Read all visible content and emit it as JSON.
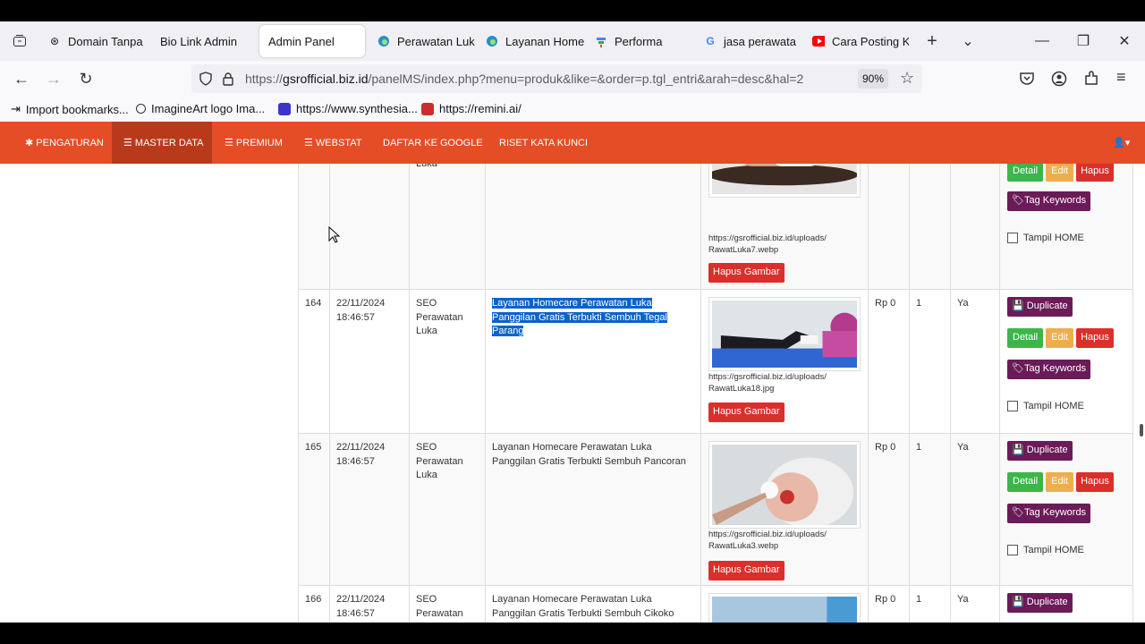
{
  "tabs": [
    {
      "label": "Domain Tanpa",
      "icon": "openai-icon"
    },
    {
      "label": "Bio Link Admin",
      "icon": ""
    },
    {
      "label": "Admin Panel",
      "icon": "",
      "active": true
    },
    {
      "label": "Perawatan Luk",
      "icon": "edge-icon"
    },
    {
      "label": "Layanan Home",
      "icon": "edge-icon"
    },
    {
      "label": "Performa",
      "icon": "search-console-icon"
    },
    {
      "label": "jasa perawata",
      "icon": "google-icon"
    },
    {
      "label": "Cara Posting K",
      "icon": "youtube-icon"
    }
  ],
  "address": {
    "prefix": "https://",
    "domain": "gsrofficial.biz.id",
    "path": "/panelMS/index.php?menu=produk&like=&order=p.tgl_entri&arah=desc&hal=2",
    "zoom": "90%"
  },
  "bookmarks": [
    "Import bookmarks...",
    "ImagineArt logo Ima...",
    "https://www.synthesia...",
    "https://remini.ai/"
  ],
  "menu": [
    "PENGATURAN",
    "MASTER DATA",
    "PREMIUM",
    "WEBSTAT",
    "DAFTAR KE GOOGLE",
    "RISET KATA KUNCI"
  ],
  "rows": [
    {
      "no": "",
      "date": "",
      "time": "",
      "cat": "Luka",
      "title": "",
      "path1": "https://gsrofficial.biz.id/uploads/",
      "path2": "RawatLuka7.webp",
      "price": "",
      "qty": "",
      "status": ""
    },
    {
      "no": "164",
      "date": "22/11/2024",
      "time": "18:46:57",
      "cat": "SEO Perawatan Luka",
      "title": "Layanan Homecare Perawatan Luka Panggilan Gratis Terbukti Sembuh Tegal Parang",
      "path1": "https://gsrofficial.biz.id/uploads/",
      "path2": "RawatLuka18.jpg",
      "price": "Rp 0",
      "qty": "1",
      "status": "Ya"
    },
    {
      "no": "165",
      "date": "22/11/2024",
      "time": "18:46:57",
      "cat": "SEO Perawatan Luka",
      "title": "Layanan Homecare Perawatan Luka Panggilan Gratis Terbukti Sembuh Pancoran",
      "path1": "https://gsrofficial.biz.id/uploads/",
      "path2": "RawatLuka3.webp",
      "price": "Rp 0",
      "qty": "1",
      "status": "Ya"
    },
    {
      "no": "166",
      "date": "22/11/2024",
      "time": "18:46:57",
      "cat": "SEO Perawatan",
      "title": "Layanan Homecare Perawatan Luka Panggilan Gratis Terbukti Sembuh Cikoko",
      "price": "Rp 0",
      "qty": "1",
      "status": "Ya"
    }
  ],
  "actions": {
    "duplicate": "Duplicate",
    "detail": "Detail",
    "edit": "Edit",
    "hapus": "Hapus",
    "tag": "Tag Keywords",
    "tampil": "Tampil HOME",
    "hapus_gambar": "Hapus Gambar"
  }
}
